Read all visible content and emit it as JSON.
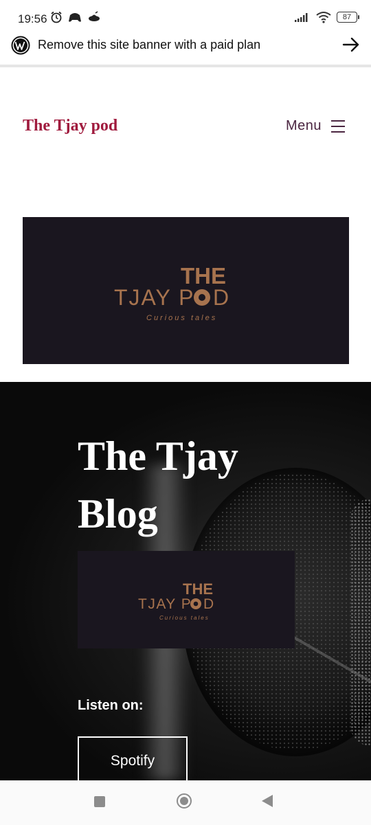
{
  "status_bar": {
    "time": "19:56",
    "battery": "87",
    "icons_left": [
      "alarm-icon",
      "game-controller-icon",
      "ufo-icon"
    ],
    "icons_right": [
      "signal-icon",
      "wifi-icon",
      "battery-icon"
    ]
  },
  "wp_banner": {
    "text": "Remove this site banner with a paid plan",
    "icon": "wordpress-icon",
    "arrow": "arrow-right-icon"
  },
  "header": {
    "site_title": "The Tjay pod",
    "menu_label": "Menu",
    "menu_icon": "hamburger-icon"
  },
  "logo": {
    "line1": "THE",
    "line2": "TJAY P",
    "line2_end": "D",
    "tagline": "Curious tales",
    "colors": {
      "bg": "#1a161f",
      "brand": "#a7734e"
    }
  },
  "hero": {
    "title": "The Tjay Blog",
    "listen_on": "Listen on:",
    "spotify_label": "Spotify"
  },
  "colors": {
    "title_accent": "#a01b3e",
    "menu_text": "#4a2540"
  },
  "navbar": {
    "icons": [
      "recent-apps-icon",
      "home-icon",
      "back-icon"
    ]
  }
}
